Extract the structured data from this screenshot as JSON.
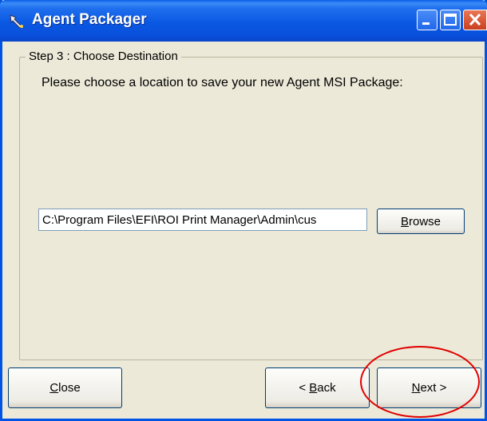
{
  "window": {
    "title": "Agent Packager"
  },
  "step": {
    "group_label": "Step 3 : Choose Destination",
    "prompt": "Please choose a location to save your new Agent MSI Package:"
  },
  "destination": {
    "path_value": "C:\\Program Files\\EFI\\ROI Print Manager\\Admin\\cus"
  },
  "buttons": {
    "browse": {
      "first": "B",
      "rest": "rowse"
    },
    "close": {
      "first": "C",
      "rest": "lose"
    },
    "back": {
      "pre": "< ",
      "first": "B",
      "rest": "ack"
    },
    "next": {
      "first": "N",
      "rest": "ext >"
    }
  },
  "colors": {
    "titlebar": "#0a58e2",
    "window_bg": "#ece9d8",
    "highlight": "#e00000"
  },
  "icons": [
    "app-icon",
    "minimize-icon",
    "maximize-icon",
    "close-icon"
  ]
}
